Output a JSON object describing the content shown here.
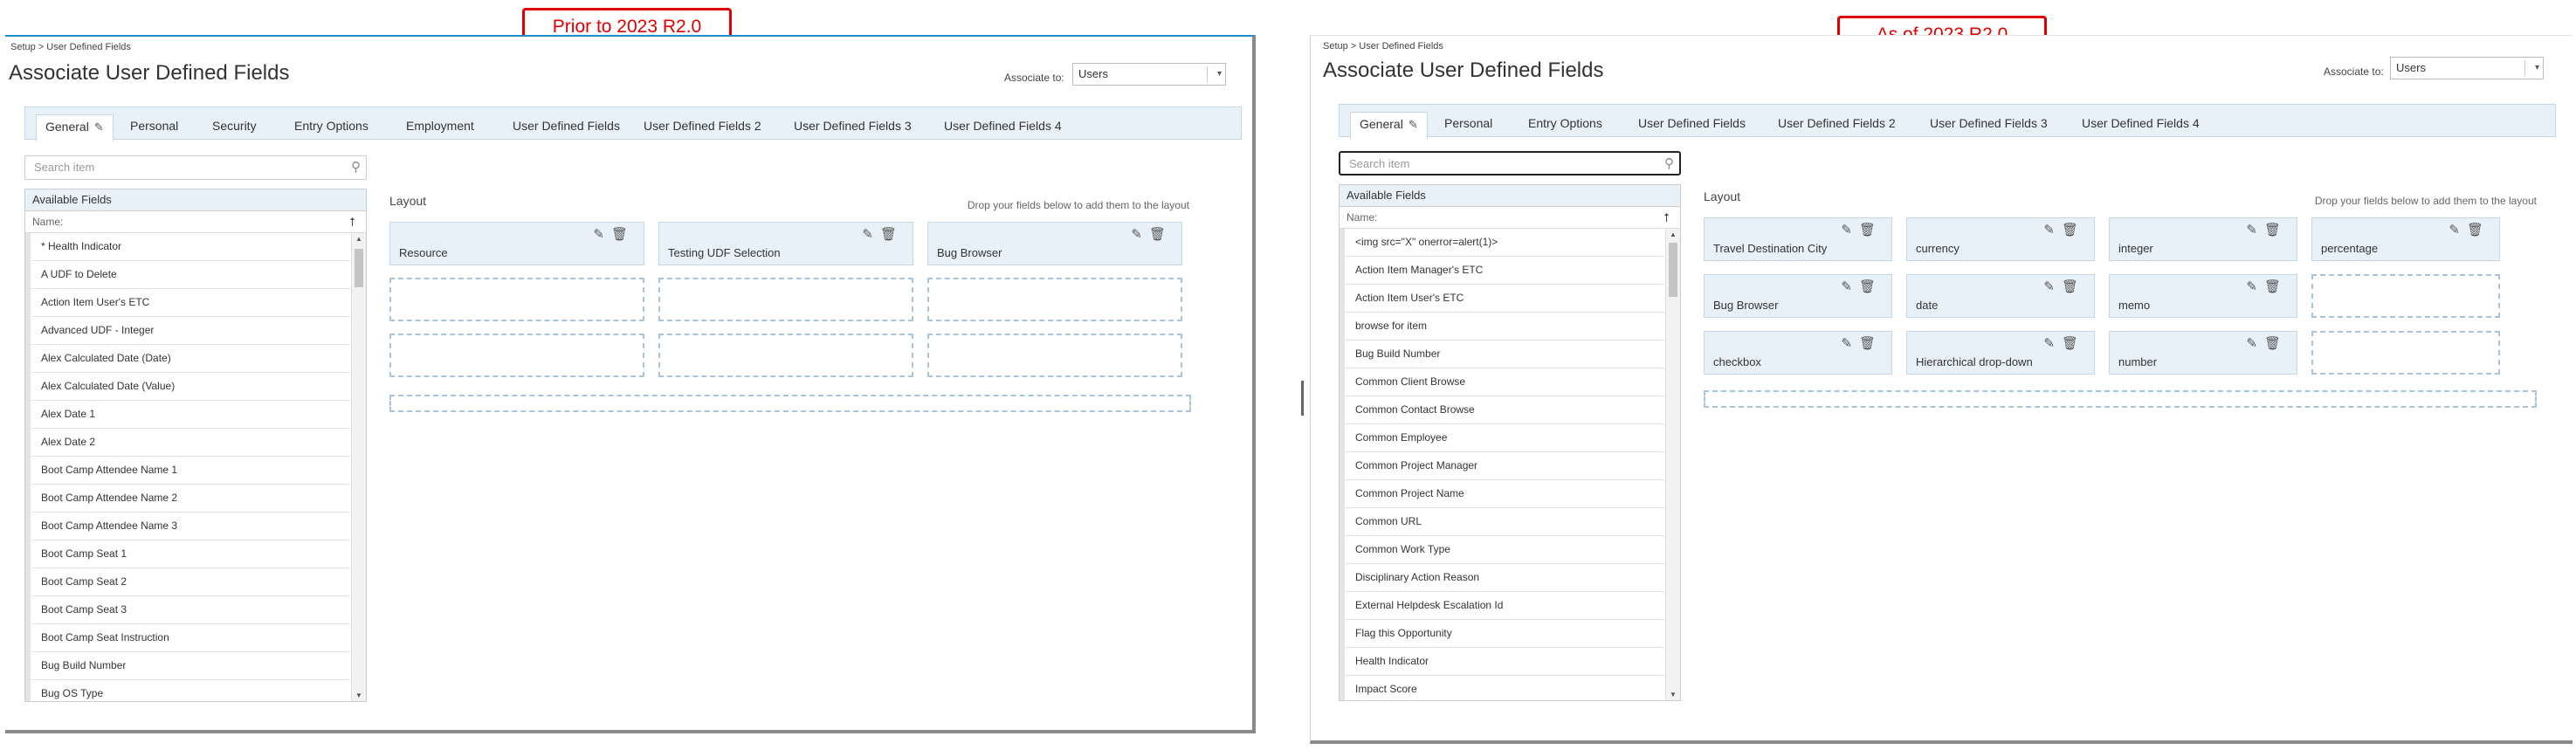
{
  "labels": {
    "left": "Prior to 2023 R2.0",
    "right": "As of 2023 R2.0"
  },
  "icons": {
    "pencil": "pencil-icon",
    "trash": "trash-icon",
    "search": "search-icon",
    "sort": "sort-icon",
    "caret": "chevron-down-icon"
  },
  "colors": {
    "accent": "#1a8fd0",
    "label_red": "#e00000",
    "tab_bg": "#e8f1f8"
  },
  "left": {
    "breadcrumb": "Setup > User Defined Fields",
    "title": "Associate User Defined Fields",
    "associate_label": "Associate to:",
    "associate_value": "Users",
    "tabs": [
      "General",
      "Personal",
      "Security",
      "Entry Options",
      "Employment",
      "User Defined Fields",
      "User Defined Fields 2",
      "User Defined Fields 3",
      "User Defined Fields 4"
    ],
    "search_placeholder": "Search item",
    "available_title": "Available Fields",
    "name_header": "Name:",
    "items": [
      "* Health Indicator",
      "A UDF to Delete",
      "Action Item User's ETC",
      "Advanced UDF - Integer",
      "Alex Calculated Date (Date)",
      "Alex Calculated Date (Value)",
      "Alex Date 1",
      "Alex Date 2",
      "Boot Camp Attendee Name 1",
      "Boot Camp Attendee Name 2",
      "Boot Camp Attendee Name 3",
      "Boot Camp Seat 1",
      "Boot Camp Seat 2",
      "Boot Camp Seat 3",
      "Boot Camp Seat Instruction",
      "Bug Build Number",
      "Bug OS Type"
    ],
    "layout_label": "Layout",
    "drop_hint": "Drop your fields below to add them to the layout",
    "layout_fields": [
      "Resource",
      "Testing UDF Selection",
      "Bug Browser"
    ]
  },
  "right": {
    "breadcrumb": "Setup > User Defined Fields",
    "title": "Associate User Defined Fields",
    "associate_label": "Associate to:",
    "associate_value": "Users",
    "tabs": [
      "General",
      "Personal",
      "Entry Options",
      "User Defined Fields",
      "User Defined Fields 2",
      "User Defined Fields 3",
      "User Defined Fields 4"
    ],
    "search_placeholder": "Search item",
    "available_title": "Available Fields",
    "name_header": "Name:",
    "items": [
      "<img src=\"X\" onerror=alert(1)>",
      "Action Item Manager's ETC",
      "Action Item User's ETC",
      "browse for item",
      "Bug Build Number",
      "Common Client Browse",
      "Common Contact Browse",
      "Common Employee",
      "Common Project Manager",
      "Common Project Name",
      "Common URL",
      "Common Work Type",
      "Disciplinary Action Reason",
      "External Helpdesk Escalation Id",
      "Flag this Opportunity",
      "Health Indicator",
      "Impact Score"
    ],
    "layout_label": "Layout",
    "drop_hint": "Drop your fields below to add them to the layout",
    "layout_fields": [
      "Travel Destination City",
      "currency",
      "integer",
      "percentage",
      "Bug Browser",
      "date",
      "memo",
      "",
      "checkbox",
      "Hierarchical drop-down",
      "number",
      ""
    ]
  }
}
